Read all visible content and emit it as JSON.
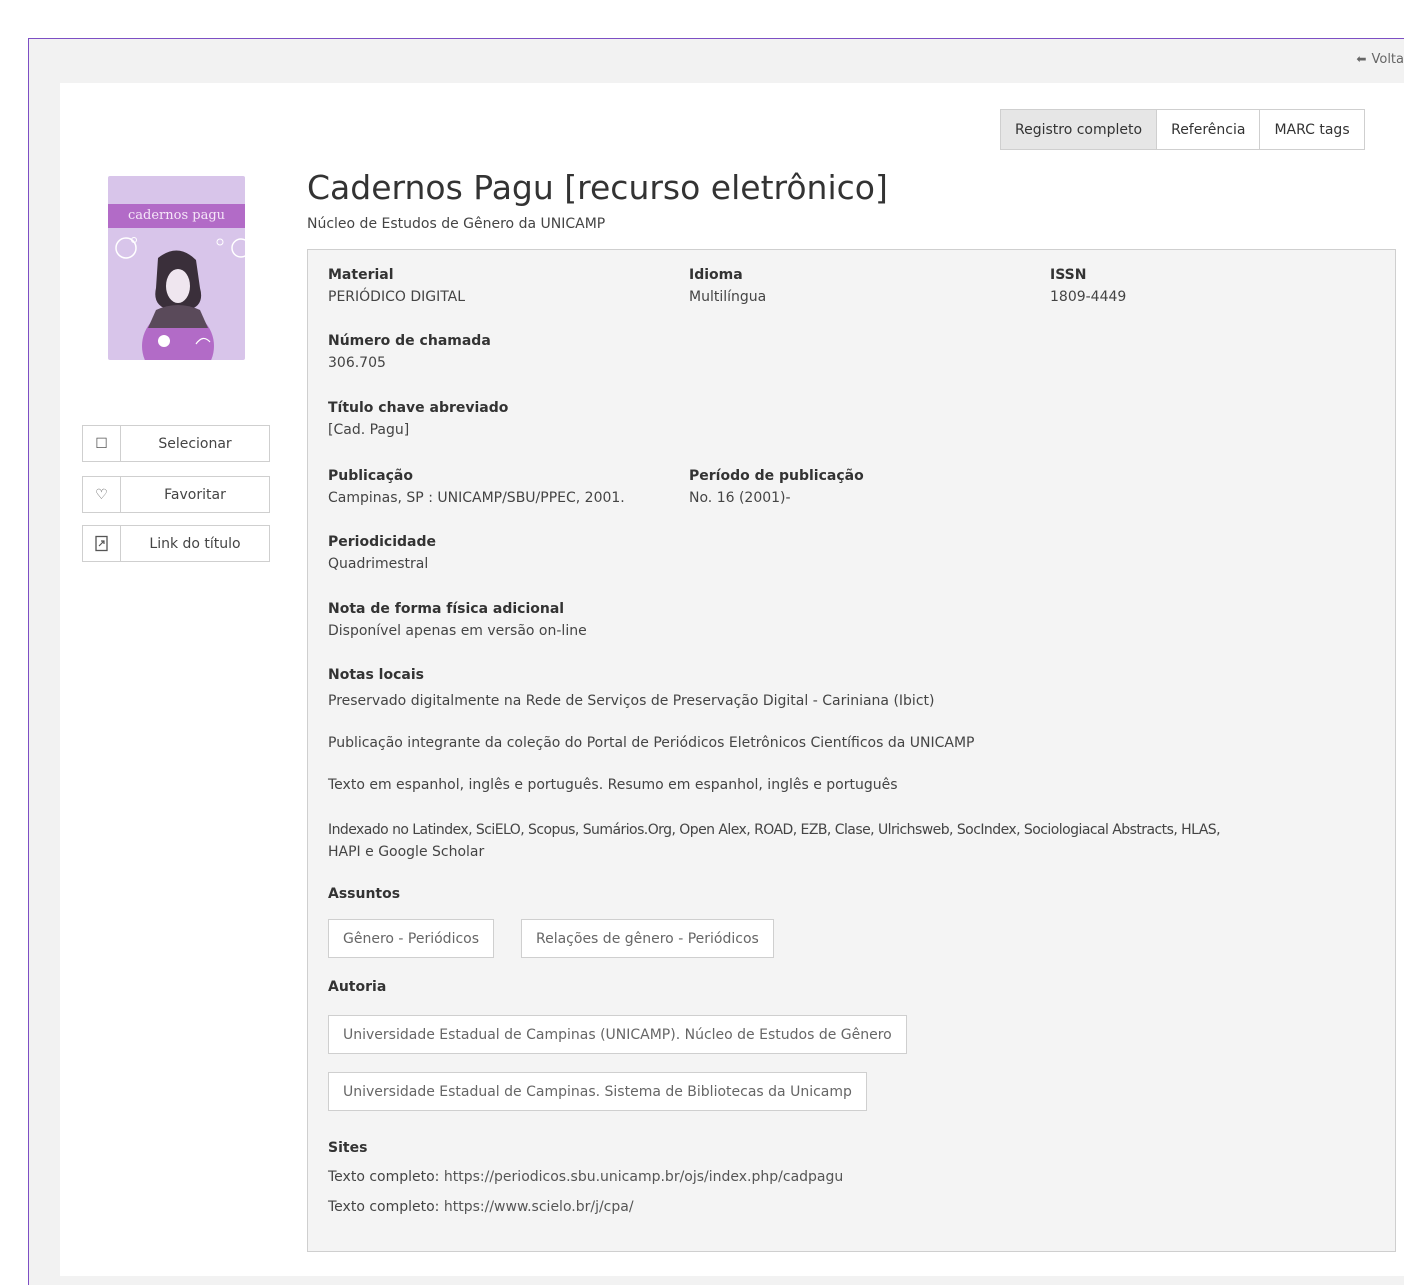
{
  "nav": {
    "back_label": "Volta"
  },
  "view_tabs": [
    "Registro completo",
    "Referência",
    "MARC tags"
  ],
  "cover": {
    "text": "cadernos pagu"
  },
  "actions": [
    {
      "label": "Selecionar",
      "icon": "checkbox-icon"
    },
    {
      "label": "Favoritar",
      "icon": "heart-icon"
    },
    {
      "label": "Link do título",
      "icon": "link-document-icon"
    }
  ],
  "record": {
    "title": "Cadernos Pagu [recurso eletrônico]",
    "subtitle": "Núcleo de Estudos de Gênero da UNICAMP",
    "material": {
      "label": "Material",
      "value": "PERIÓDICO DIGITAL"
    },
    "idioma": {
      "label": "Idioma",
      "value": "Multilíngua"
    },
    "issn": {
      "label": "ISSN",
      "value": "1809-4449"
    },
    "chamada": {
      "label": "Número de chamada",
      "value": "306.705"
    },
    "titulo_chave": {
      "label": "Título chave abreviado",
      "value": "[Cad. Pagu]"
    },
    "publicacao": {
      "label": "Publicação",
      "value": "Campinas, SP : UNICAMP/SBU/PPEC, 2001."
    },
    "periodo": {
      "label": "Período de publicação",
      "value": "No. 16 (2001)-"
    },
    "periodicidade": {
      "label": "Periodicidade",
      "value": "Quadrimestral"
    },
    "nota_forma": {
      "label": "Nota de forma física adicional",
      "value": "Disponível apenas em versão on-line"
    },
    "notas_locais": {
      "label": "Notas locais",
      "items": [
        "Preservado digitalmente na Rede de Serviços de Preservação Digital - Cariniana (Ibict)",
        "Publicação integrante da coleção do Portal de Periódicos Eletrônicos Científicos da UNICAMP",
        "Texto em espanhol, inglês e português. Resumo em espanhol, inglês e português",
        "Indexado no Latindex, SciELO, Scopus, Sumários.Org, Open Alex, ROAD, EZB, Clase, Ulrichsweb, SocIndex, Sociologiacal Abstracts, HLAS,",
        "HAPI e Google Scholar"
      ]
    },
    "assuntos": {
      "label": "Assuntos",
      "items": [
        "Gênero - Periódicos",
        "Relações de gênero - Periódicos"
      ]
    },
    "autoria": {
      "label": "Autoria",
      "items": [
        "Universidade Estadual de Campinas (UNICAMP). Núcleo de Estudos de Gênero",
        "Universidade Estadual de Campinas. Sistema de Bibliotecas da Unicamp"
      ]
    },
    "sites": {
      "label": "Sites",
      "items": [
        {
          "prefix": "Texto completo:",
          "url": "https://periodicos.sbu.unicamp.br/ojs/index.php/cadpagu"
        },
        {
          "prefix": "Texto completo:",
          "url": "https://www.scielo.br/j/cpa/"
        }
      ]
    }
  }
}
